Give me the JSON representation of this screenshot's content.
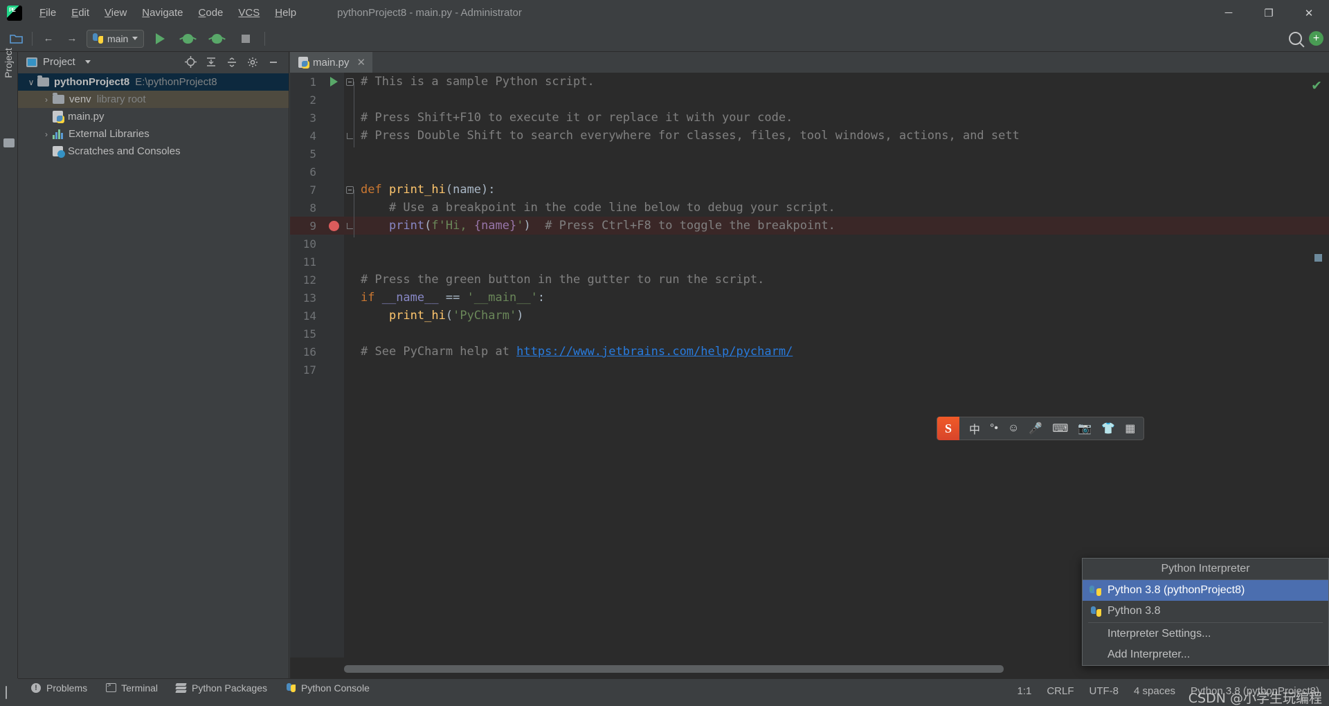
{
  "window": {
    "title": "pythonProject8 - main.py - Administrator",
    "logo_alt": "pycharm-logo",
    "minimize": "─",
    "maximize": "❐",
    "close": "✕"
  },
  "menubar": {
    "items": [
      {
        "mnemonic": "F",
        "rest": "ile"
      },
      {
        "mnemonic": "E",
        "rest": "dit"
      },
      {
        "mnemonic": "V",
        "rest": "iew"
      },
      {
        "mnemonic": "N",
        "rest": "avigate"
      },
      {
        "mnemonic": "C",
        "rest": "ode"
      },
      {
        "mnemonic": "VCS",
        "rest": ""
      },
      {
        "mnemonic": "H",
        "rest": "elp"
      }
    ]
  },
  "toolbar": {
    "open_label": "open-folder",
    "back_label": "←",
    "forward_label": "→",
    "run_config_name": "main",
    "run_label": "run",
    "debug_label": "debug",
    "coverage_label": "run-with-coverage",
    "stop_label": "stop",
    "search_label": "search-everywhere",
    "updates_label": "+"
  },
  "rail": {
    "project_label": "Project"
  },
  "project_panel": {
    "title": "Project",
    "actions": [
      "locate",
      "expand-all",
      "collapse-all",
      "settings",
      "hide"
    ],
    "tree": [
      {
        "name": "pythonProject8",
        "sub": "E:\\pythonProject8",
        "arrow": "∨",
        "kind": "folder",
        "selected": true
      },
      {
        "name": "venv",
        "sub": "library root",
        "arrow": "›",
        "kind": "folder",
        "highlighted": true
      },
      {
        "name": "main.py",
        "sub": "",
        "arrow": "",
        "kind": "pyfile"
      },
      {
        "name": "External Libraries",
        "sub": "",
        "arrow": "›",
        "kind": "library"
      },
      {
        "name": "Scratches and Consoles",
        "sub": "",
        "arrow": "",
        "kind": "scratch"
      }
    ]
  },
  "editor": {
    "tab": {
      "label": "main.py",
      "close": "✕"
    },
    "caret_position": "1:1",
    "lines": [
      {
        "num": "1",
        "indent": 0,
        "tokens": [
          {
            "t": "# This is a sample Python script.",
            "c": "c-com"
          }
        ],
        "gutter": "run",
        "fold": "start"
      },
      {
        "num": "2",
        "indent": 0,
        "tokens": []
      },
      {
        "num": "3",
        "indent": 0,
        "tokens": [
          {
            "t": "# Press Shift+F10 to execute it or replace it with your code.",
            "c": "c-com"
          }
        ]
      },
      {
        "num": "4",
        "indent": 0,
        "tokens": [
          {
            "t": "# Press Double Shift to search everywhere for classes, files, tool windows, actions, and sett",
            "c": "c-com"
          }
        ],
        "fold": "end"
      },
      {
        "num": "5",
        "indent": 0,
        "tokens": []
      },
      {
        "num": "6",
        "indent": 0,
        "tokens": []
      },
      {
        "num": "7",
        "indent": 0,
        "tokens": [
          {
            "t": "def ",
            "c": "c-kw"
          },
          {
            "t": "print_hi",
            "c": "c-fn"
          },
          {
            "t": "(",
            "c": "c-par"
          },
          {
            "t": "name",
            "c": "c-par"
          },
          {
            "t": "):",
            "c": "c-par"
          }
        ],
        "fold": "start"
      },
      {
        "num": "8",
        "indent": 4,
        "tokens": [
          {
            "t": "# Use a breakpoint in the code line below to debug your script.",
            "c": "c-com"
          }
        ]
      },
      {
        "num": "9",
        "indent": 4,
        "tokens": [
          {
            "t": "print",
            "c": "c-bi"
          },
          {
            "t": "(",
            "c": "c-par"
          },
          {
            "t": "f'Hi, ",
            "c": "c-str"
          },
          {
            "t": "{",
            "c": "c-var"
          },
          {
            "t": "name",
            "c": "c-var"
          },
          {
            "t": "}",
            "c": "c-var"
          },
          {
            "t": "'",
            "c": "c-str"
          },
          {
            "t": ")",
            "c": "c-par"
          },
          {
            "t": "  # Press Ctrl+F8 to toggle the breakpoint.",
            "c": "c-com"
          }
        ],
        "gutter": "breakpoint",
        "fold": "end",
        "highlight": true
      },
      {
        "num": "10",
        "indent": 0,
        "tokens": []
      },
      {
        "num": "11",
        "indent": 0,
        "tokens": []
      },
      {
        "num": "12",
        "indent": 0,
        "tokens": [
          {
            "t": "# Press the green button in the gutter to run the script.",
            "c": "c-com"
          }
        ]
      },
      {
        "num": "13",
        "indent": 0,
        "tokens": [
          {
            "t": "if ",
            "c": "c-kw"
          },
          {
            "t": "__name__",
            "c": "c-bi"
          },
          {
            "t": " == ",
            "c": "c-par"
          },
          {
            "t": "'__main__'",
            "c": "c-str"
          },
          {
            "t": ":",
            "c": "c-par"
          }
        ]
      },
      {
        "num": "14",
        "indent": 4,
        "tokens": [
          {
            "t": "print_hi",
            "c": "c-fn"
          },
          {
            "t": "(",
            "c": "c-par"
          },
          {
            "t": "'PyCharm'",
            "c": "c-str"
          },
          {
            "t": ")",
            "c": "c-par"
          }
        ]
      },
      {
        "num": "15",
        "indent": 0,
        "tokens": []
      },
      {
        "num": "16",
        "indent": 0,
        "tokens": [
          {
            "t": "# See PyCharm help at ",
            "c": "c-com"
          },
          {
            "t": "https://www.jetbrains.com/help/pycharm/",
            "c": "c-lnk"
          }
        ]
      },
      {
        "num": "17",
        "indent": 0,
        "tokens": []
      }
    ],
    "inspection_status": "✔"
  },
  "ime": {
    "logo": "S",
    "items": [
      "中",
      "°•",
      "☺",
      "🎤",
      "⌨",
      "📷",
      "👕",
      "▦"
    ]
  },
  "popup": {
    "title": "Python Interpreter",
    "items": [
      {
        "label": "Python 3.8 (pythonProject8)",
        "icon": "python-venv",
        "selected": true
      },
      {
        "label": "Python 3.8",
        "icon": "python",
        "selected": false
      },
      {
        "label": "Interpreter Settings...",
        "icon": "",
        "selected": false
      },
      {
        "label": "Add Interpreter...",
        "icon": "",
        "selected": false
      }
    ]
  },
  "toolwindows": {
    "items": [
      {
        "label": "Problems",
        "icon": "problems-icon"
      },
      {
        "label": "Terminal",
        "icon": "terminal-icon"
      },
      {
        "label": "Python Packages",
        "icon": "packages-icon"
      },
      {
        "label": "Python Console",
        "icon": "python-console-icon"
      }
    ]
  },
  "statusbar": {
    "position": "1:1",
    "line_separator": "CRLF",
    "encoding": "UTF-8",
    "indent": "4 spaces",
    "interpreter": "Python 3.8 (pythonProject8)"
  },
  "watermark": "CSDN @小学生玩编程",
  "colors": {
    "background": "#3c3f41",
    "editor_background": "#2b2b2b",
    "accent_blue": "#4b6eaf",
    "selection_blue": "#0d293e",
    "highlight_olive": "#4e4a3f",
    "green": "#59a869",
    "breakpoint_red": "#db5c5c",
    "comment_gray": "#808080",
    "keyword_orange": "#cc7832",
    "string_green": "#6a8759",
    "function_yellow": "#ffc66d",
    "link_blue": "#287bde"
  }
}
